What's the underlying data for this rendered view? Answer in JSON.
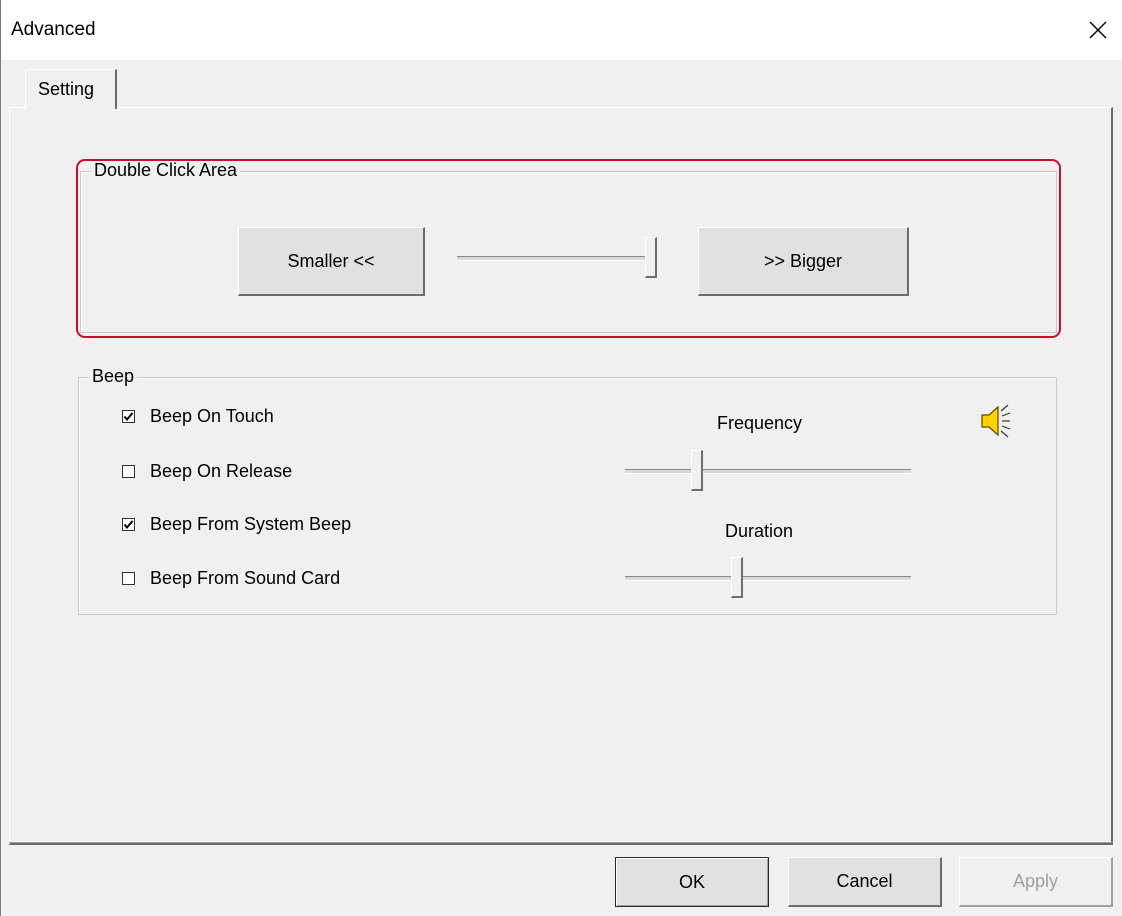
{
  "window": {
    "title": "Advanced"
  },
  "tabs": [
    {
      "label": "Setting",
      "selected": true
    }
  ],
  "double_click_area": {
    "title": "Double Click Area",
    "smaller_label": "Smaller <<",
    "bigger_label": ">> Bigger",
    "slider_value": 1.0
  },
  "beep": {
    "title": "Beep",
    "options": [
      {
        "label": "Beep On Touch",
        "checked": true
      },
      {
        "label": "Beep On Release",
        "checked": false
      },
      {
        "label": "Beep From System Beep",
        "checked": true
      },
      {
        "label": "Beep From Sound Card",
        "checked": false
      }
    ],
    "frequency_label": "Frequency",
    "frequency_value": 0.25,
    "duration_label": "Duration",
    "duration_value": 0.39,
    "icon": "speaker-icon"
  },
  "footer": {
    "ok_label": "OK",
    "cancel_label": "Cancel",
    "apply_label": "Apply",
    "apply_enabled": false
  },
  "colors": {
    "highlight": "#c8102e",
    "window_bg": "#f0f0f0",
    "speaker_fill": "#ffd200"
  }
}
